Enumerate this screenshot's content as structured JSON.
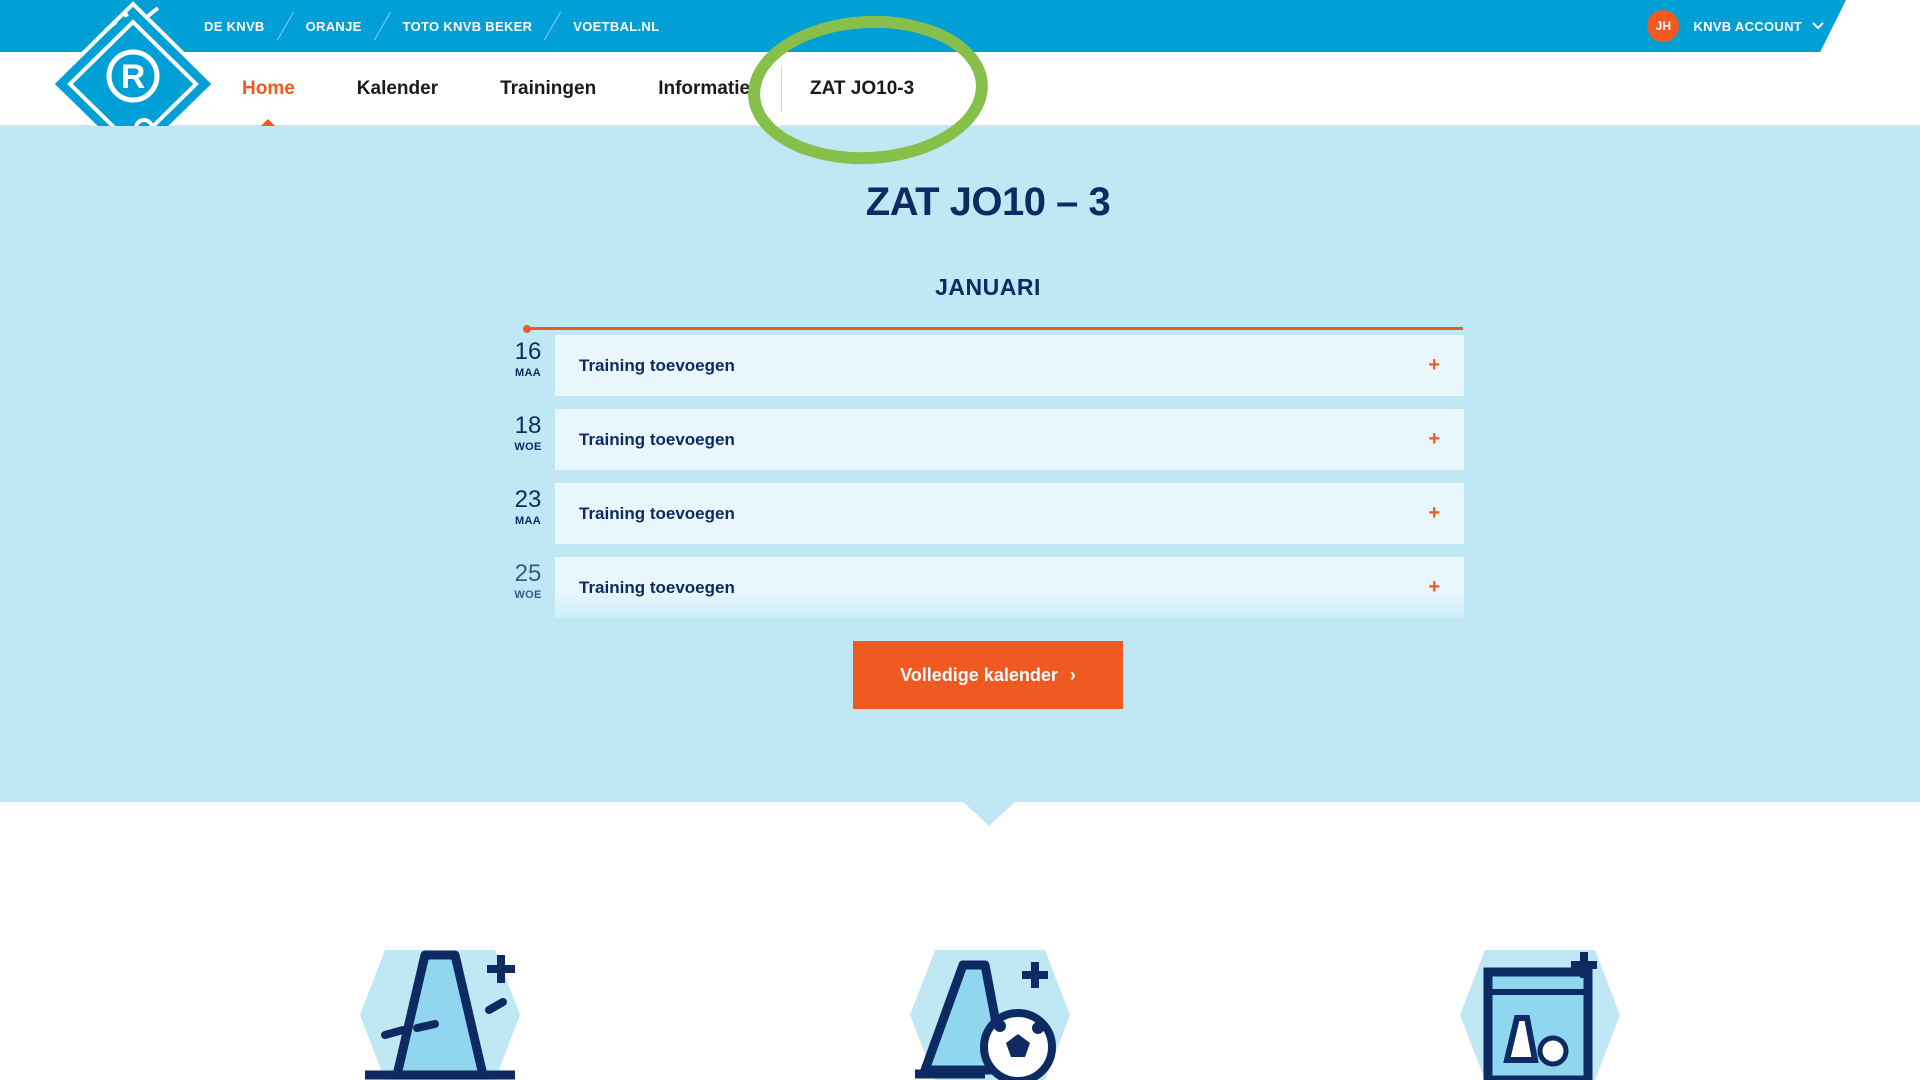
{
  "topbar": {
    "links": [
      "DE KNVB",
      "ORANJE",
      "TOTO KNVB BEKER",
      "VOETBAL.NL"
    ],
    "account_initials": "JH",
    "account_label": "KNVB ACCOUNT"
  },
  "nav": {
    "items": [
      "Home",
      "Kalender",
      "Trainingen",
      "Informatie"
    ],
    "team": "ZAT JO10-3"
  },
  "main": {
    "title": "ZAT JO10 – 3",
    "month": "JANUARI",
    "rows": [
      {
        "date": "16",
        "day": "MAA",
        "label": "Training toevoegen",
        "action": "+"
      },
      {
        "date": "18",
        "day": "WOE",
        "label": "Training toevoegen",
        "action": "+"
      },
      {
        "date": "23",
        "day": "MAA",
        "label": "Training toevoegen",
        "action": "+"
      },
      {
        "date": "25",
        "day": "WOE",
        "label": "Training toevoegen",
        "action": "+"
      }
    ],
    "cta_label": "Volledige kalender",
    "cta_arrow": "›"
  },
  "colors": {
    "topbar": "#009fd6",
    "accent": "#f05a22",
    "navy": "#0e2a63",
    "band": "#bfe8f4",
    "card": "#e9f7fc",
    "highlight": "#86c04a"
  },
  "icons": [
    "knvb-logo-icon",
    "cone-plus-icon",
    "cone-ball-plus-icon",
    "board-plus-icon",
    "chevron-down-icon",
    "chevron-right-icon",
    "plus-icon"
  ]
}
